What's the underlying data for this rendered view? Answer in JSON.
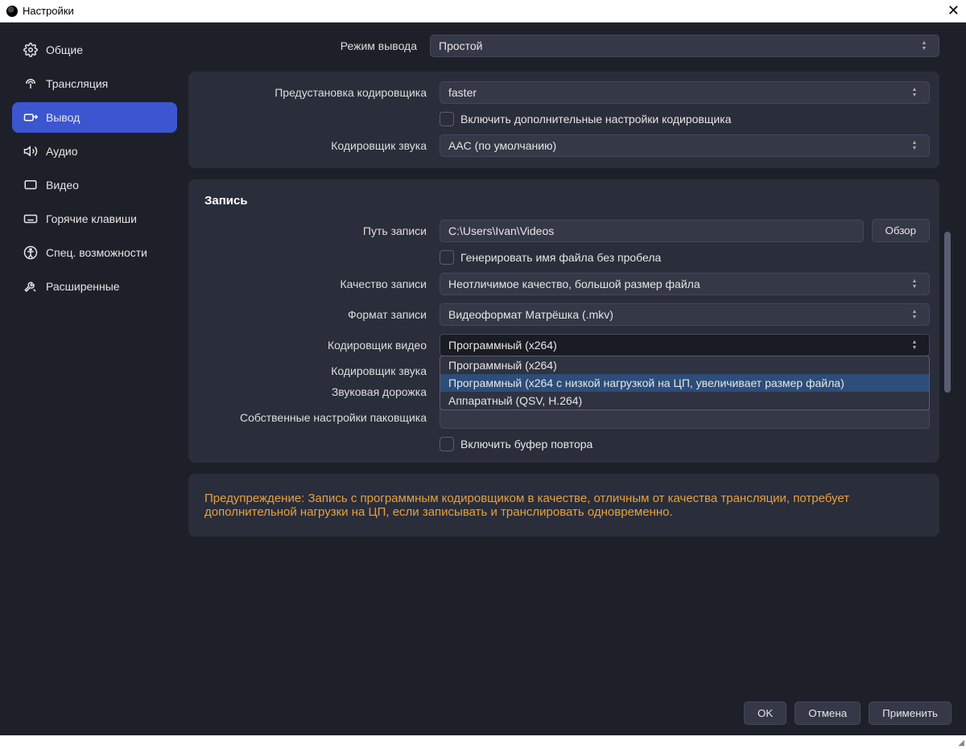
{
  "window": {
    "title": "Настройки"
  },
  "sidebar": {
    "items": [
      {
        "label": "Общие"
      },
      {
        "label": "Трансляция"
      },
      {
        "label": "Вывод"
      },
      {
        "label": "Аудио"
      },
      {
        "label": "Видео"
      },
      {
        "label": "Горячие клавиши"
      },
      {
        "label": "Спец. возможности"
      },
      {
        "label": "Расширенные"
      }
    ]
  },
  "output_mode": {
    "label": "Режим вывода",
    "value": "Простой"
  },
  "encoder": {
    "preset_label": "Предустановка кодировщика",
    "preset_value": "faster",
    "enable_advanced_label": "Включить дополнительные настройки кодировщика",
    "audio_encoder_label": "Кодировщик звука",
    "audio_encoder_value": "AAC (по умолчанию)"
  },
  "recording": {
    "section_title": "Запись",
    "path_label": "Путь записи",
    "path_value": "C:\\Users\\Ivan\\Videos",
    "browse_label": "Обзор",
    "no_space_filename_label": "Генерировать имя файла без пробела",
    "quality_label": "Качество записи",
    "quality_value": "Неотличимое качество, большой размер файла",
    "format_label": "Формат записи",
    "format_value": "Видеоформат Матрёшка (.mkv)",
    "video_encoder_label": "Кодировщик видео",
    "video_encoder_value": "Программный (x264)",
    "video_encoder_options": [
      "Программный (x264)",
      "Программный (x264 с низкой нагрузкой на ЦП, увеличивает размер файла)",
      "Аппаратный (QSV, H.264)"
    ],
    "audio_encoder_label": "Кодировщик звука",
    "audio_track_label": "Звуковая дорожка",
    "muxer_settings_label": "Собственные настройки паковщика",
    "muxer_settings_value": "",
    "replay_buffer_label": "Включить буфер повтора"
  },
  "warning": {
    "text": "Предупреждение: Запись с программным кодировщиком в качестве, отличным от качества трансляции, потребует дополнительной нагрузки на ЦП, если записывать и транслировать одновременно."
  },
  "footer": {
    "ok": "OK",
    "cancel": "Отмена",
    "apply": "Применить"
  }
}
